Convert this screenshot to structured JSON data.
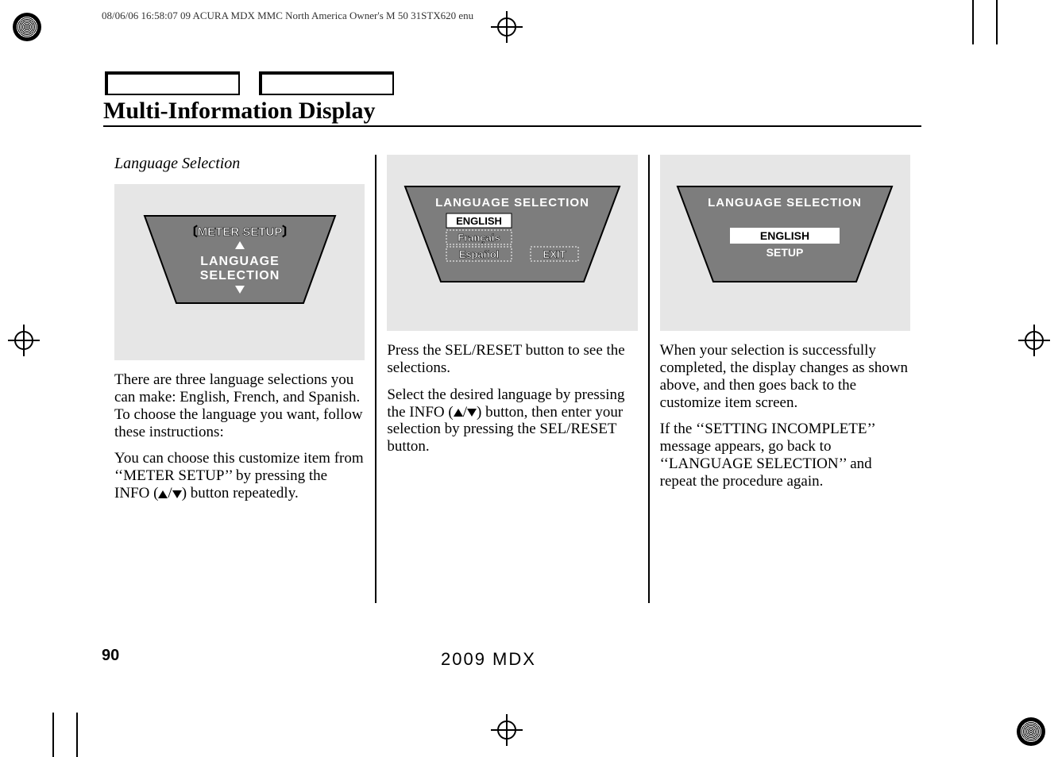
{
  "header": {
    "stamp": "08/06/06 16:58:07   09 ACURA MDX MMC North America Owner's M 50 31STX620 enu"
  },
  "page": {
    "title": "Multi-Information Display",
    "subtitle": "Language Selection",
    "number": "90",
    "footer_model": "2009  MDX"
  },
  "col1": {
    "screen": {
      "line1": "〔METER SETUP〕",
      "line2": "LANGUAGE",
      "line3": "SELECTION"
    },
    "p1": "There are three language selections you can make: English, French, and Spanish. To choose the language you want, follow these instructions:",
    "p2_a": "You can choose this customize item from ‘‘METER SETUP’’ by pressing the INFO (",
    "p2_b": ") button repeatedly."
  },
  "col2": {
    "screen": {
      "title": "LANGUAGE SELECTION",
      "opt1": "ENGLISH",
      "opt2": "Français",
      "opt3": "Español",
      "exit": "EXIT"
    },
    "p1": "Press the SEL/RESET button to see the selections.",
    "p2_a": "Select the desired language by pressing the INFO (",
    "p2_b": ") button, then enter your selection by pressing the SEL/RESET button."
  },
  "col3": {
    "screen": {
      "title": "LANGUAGE SELECTION",
      "line1": "ENGLISH",
      "line2": "SETUP"
    },
    "p1": "When your selection is successfully completed, the display changes as shown above, and then goes back to the customize item screen.",
    "p2": "If the ‘‘SETTING INCOMPLETE’’ message appears, go back to ‘‘LANGUAGE SELECTION’’ and repeat the procedure again."
  }
}
